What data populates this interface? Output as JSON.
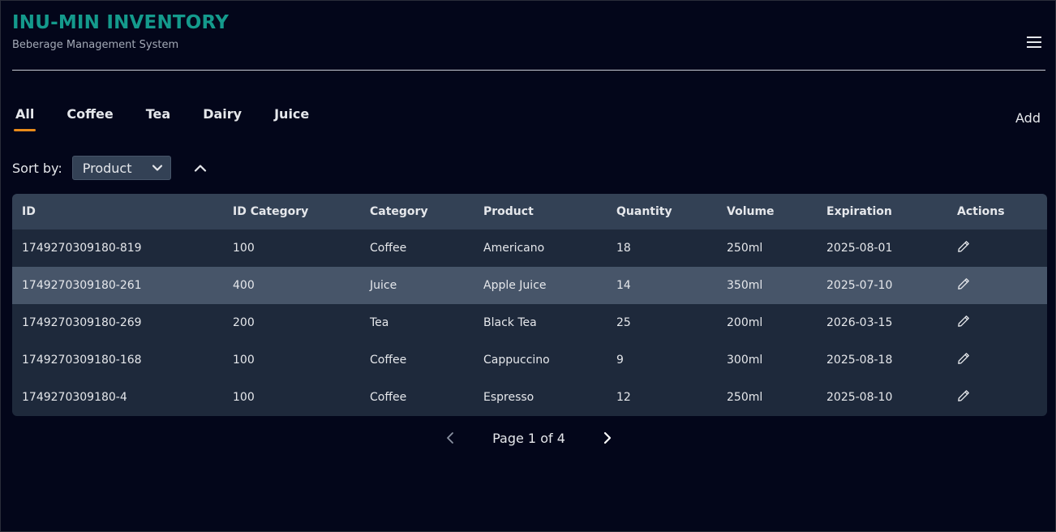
{
  "app": {
    "title": "INU-MIN INVENTORY",
    "subtitle": "Beberage Management System"
  },
  "tabs": [
    {
      "label": "All",
      "active": true
    },
    {
      "label": "Coffee",
      "active": false
    },
    {
      "label": "Tea",
      "active": false
    },
    {
      "label": "Dairy",
      "active": false
    },
    {
      "label": "Juice",
      "active": false
    }
  ],
  "add_label": "Add",
  "sort": {
    "label": "Sort by:",
    "selected": "Product",
    "order": "ascending"
  },
  "table": {
    "columns": [
      "ID",
      "ID Category",
      "Category",
      "Product",
      "Quantity",
      "Volume",
      "Expiration",
      "Actions"
    ],
    "rows": [
      {
        "id": "1749270309180-819",
        "id_category": "100",
        "category": "Coffee",
        "product": "Americano",
        "quantity": "18",
        "volume": "250ml",
        "expiration": "2025-08-01"
      },
      {
        "id": "1749270309180-261",
        "id_category": "400",
        "category": "Juice",
        "product": "Apple Juice",
        "quantity": "14",
        "volume": "350ml",
        "expiration": "2025-07-10"
      },
      {
        "id": "1749270309180-269",
        "id_category": "200",
        "category": "Tea",
        "product": "Black Tea",
        "quantity": "25",
        "volume": "200ml",
        "expiration": "2026-03-15"
      },
      {
        "id": "1749270309180-168",
        "id_category": "100",
        "category": "Coffee",
        "product": "Cappuccino",
        "quantity": "9",
        "volume": "300ml",
        "expiration": "2025-08-18"
      },
      {
        "id": "1749270309180-4",
        "id_category": "100",
        "category": "Coffee",
        "product": "Espresso",
        "quantity": "12",
        "volume": "250ml",
        "expiration": "2025-08-10"
      }
    ]
  },
  "pagination": {
    "text": "Page 1 of 4"
  },
  "colors": {
    "background": "#03061a",
    "brand": "#149a8c",
    "tab_indicator": "#e88a1a",
    "table_header": "#334155",
    "table_row": "#1e293b",
    "table_row_highlight": "#475569"
  },
  "icons": {
    "menu": "hamburger-menu-icon",
    "select": "chevron-down-icon",
    "sort_order": "chevron-up-icon",
    "edit": "pencil-icon",
    "prev": "chevron-left-icon",
    "next": "chevron-right-icon"
  }
}
